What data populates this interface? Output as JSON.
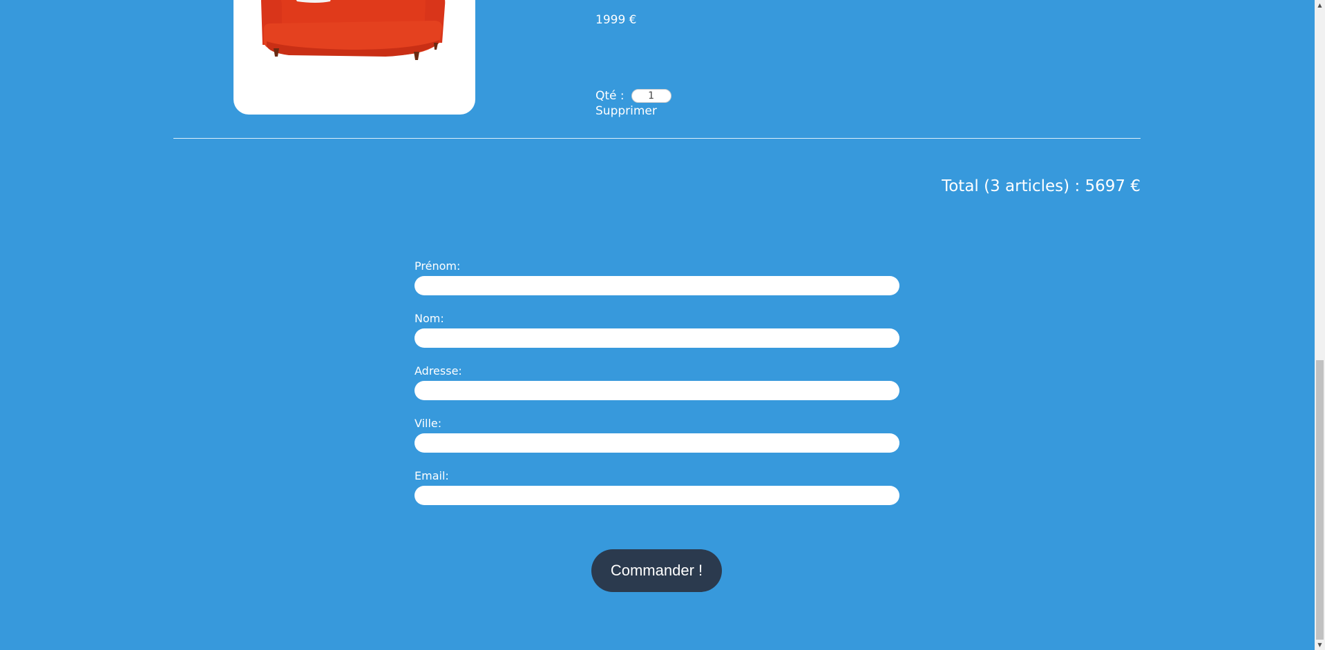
{
  "cart": {
    "item": {
      "image_alt": "Canapé rouge",
      "price": "1999 €",
      "qty_label": "Qté :",
      "qty_value": "1",
      "delete_label": "Supprimer"
    },
    "total": "Total (3 articles) : 5697 €"
  },
  "form": {
    "fields": [
      {
        "label": "Prénom:"
      },
      {
        "label": "Nom:"
      },
      {
        "label": "Adresse:"
      },
      {
        "label": "Ville:"
      },
      {
        "label": "Email:"
      }
    ],
    "submit_label": "Commander !"
  },
  "scrollbar": {
    "up_icon": "▲",
    "down_icon": "▼"
  },
  "colors": {
    "background": "#3799dc",
    "button": "#2b3a4e",
    "sofa": "#e2381a"
  }
}
